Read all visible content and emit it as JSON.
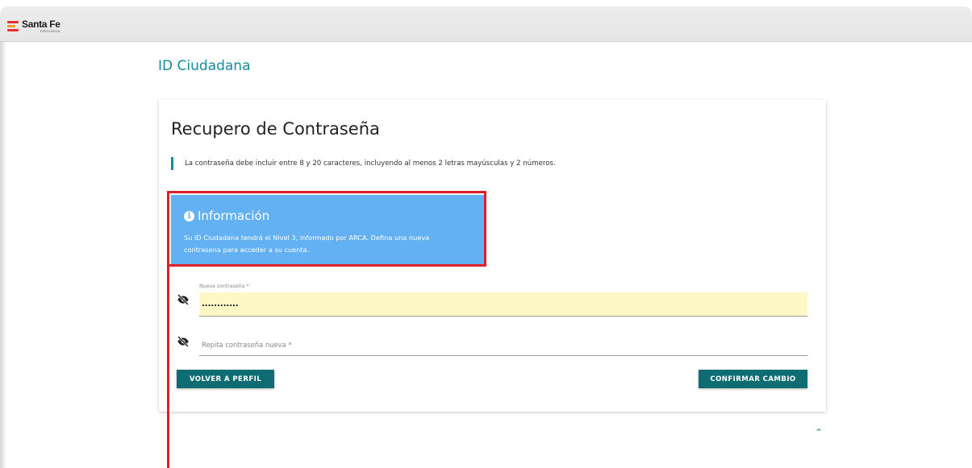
{
  "header": {
    "logo_title": "Santa Fe",
    "logo_subtitle": "PROVINCIA"
  },
  "app": {
    "title": "ID Ciudadana"
  },
  "card": {
    "title": "Recupero de Contraseña",
    "note": "La contraseña debe incluir entre 8 y 20 caracteres, incluyendo al menos 2 letras mayúsculas y 2 números."
  },
  "info": {
    "icon": "info-circle-icon",
    "title": "Información",
    "body": "Su ID Ciudadana tendrá el Nivel 3, informado por ARCA. Defina una nueva contrasena para acceder a su cuenta."
  },
  "form": {
    "new_password": {
      "label": "Nueva contraseña *",
      "value": "............",
      "icon": "eye-off-icon"
    },
    "repeat_password": {
      "placeholder": "Repita contraseña nueva *",
      "icon": "eye-off-icon"
    }
  },
  "buttons": {
    "back": "VOLVER A PERFIL",
    "confirm": "CONFIRMAR CAMBIO"
  },
  "colors": {
    "accent": "#138c9c",
    "button": "#0f6c73",
    "info_bg": "#63b0f2",
    "autofill_bg": "#fdf8c5",
    "highlight": "#e02027"
  }
}
